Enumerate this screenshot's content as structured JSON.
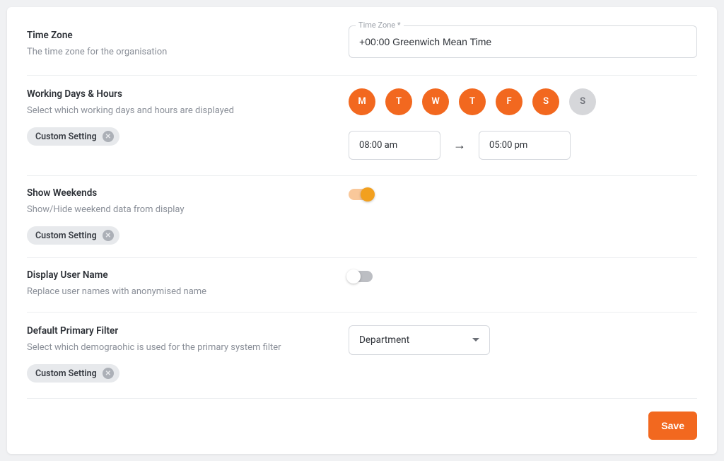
{
  "timezone": {
    "title": "Time Zone",
    "desc": "The time zone for the organisation",
    "label": "Time Zone *",
    "value": "+00:00 Greenwich Mean Time"
  },
  "workingDays": {
    "title": "Working Days & Hours",
    "desc": "Select which working days and hours are displayed",
    "chip": "Custom Setting",
    "days": [
      {
        "letter": "M",
        "on": true
      },
      {
        "letter": "T",
        "on": true
      },
      {
        "letter": "W",
        "on": true
      },
      {
        "letter": "T",
        "on": true
      },
      {
        "letter": "F",
        "on": true
      },
      {
        "letter": "S",
        "on": true
      },
      {
        "letter": "S",
        "on": false
      }
    ],
    "start": "08:00 am",
    "end": "05:00 pm"
  },
  "showWeekends": {
    "title": "Show Weekends",
    "desc": "Show/Hide weekend data from display",
    "chip": "Custom Setting",
    "on": true
  },
  "displayUserName": {
    "title": "Display User Name",
    "desc": "Replace user names with anonymised name",
    "on": false
  },
  "primaryFilter": {
    "title": "Default Primary Filter",
    "desc": "Select which demograohic is used for the primary system filter",
    "chip": "Custom Setting",
    "value": "Department"
  },
  "saveLabel": "Save"
}
